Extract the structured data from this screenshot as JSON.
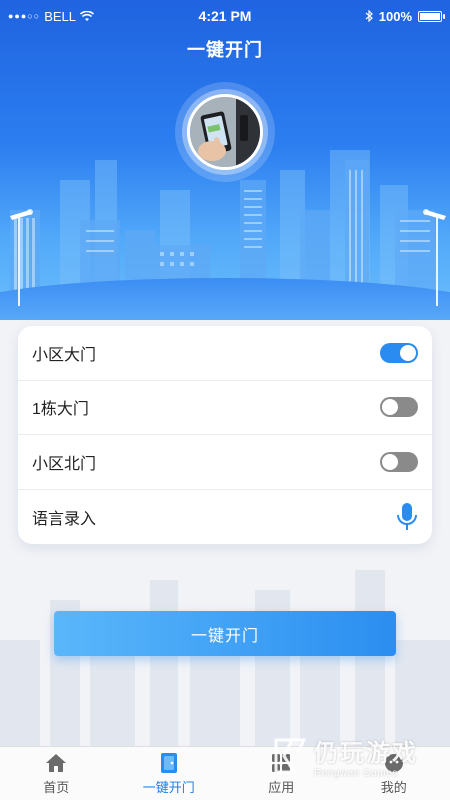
{
  "status_bar": {
    "carrier": "BELL",
    "time": "4:21 PM",
    "battery": "100%"
  },
  "header": {
    "title": "一键开门"
  },
  "doors": [
    {
      "label": "小区大门",
      "enabled": true
    },
    {
      "label": "1栋大门",
      "enabled": false
    },
    {
      "label": "小区北门",
      "enabled": false
    }
  ],
  "voice": {
    "label": "语言录入",
    "icon": "microphone-icon"
  },
  "main_button": {
    "label": "一键开门"
  },
  "tabbar": {
    "items": [
      {
        "label": "首页",
        "icon": "home-icon",
        "active": false
      },
      {
        "label": "一键开门",
        "icon": "door-icon",
        "active": true
      },
      {
        "label": "应用",
        "icon": "apps-grid-icon",
        "active": false
      },
      {
        "label": "我的",
        "icon": "profile-icon",
        "active": false
      }
    ]
  },
  "watermark": {
    "name": "仍玩游戏",
    "subtitle": "Rengwan Games"
  },
  "colors": {
    "accent": "#2a8cf0",
    "hero_top": "#1f63e0",
    "toggle_off": "#8a8a8a"
  }
}
